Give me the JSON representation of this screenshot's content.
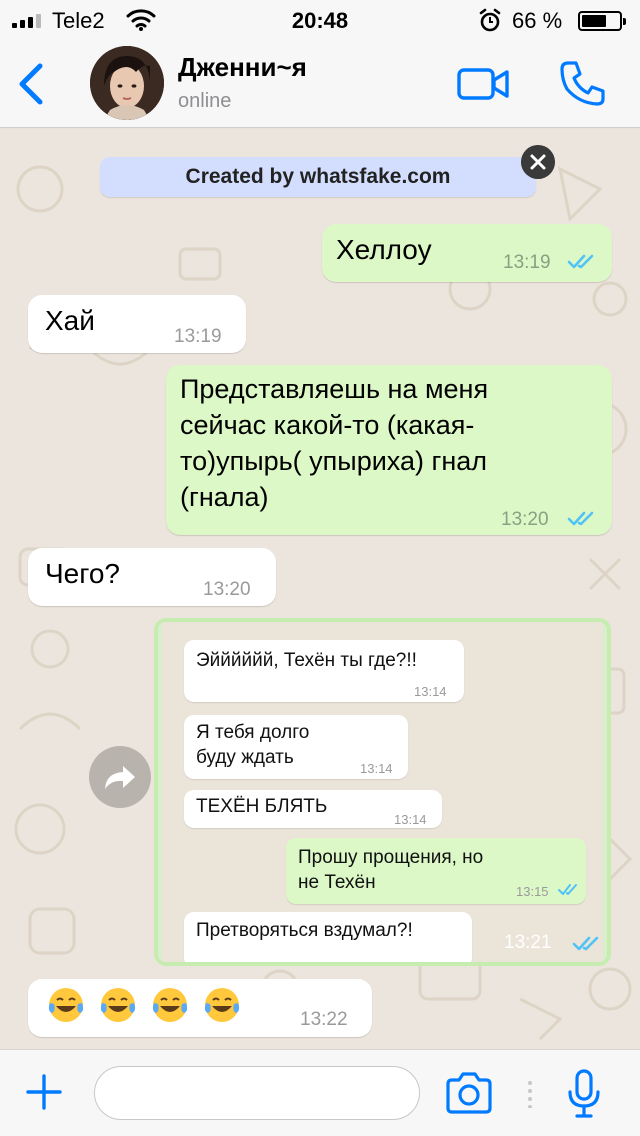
{
  "status_bar": {
    "carrier": "Tele2",
    "time": "20:48",
    "battery_percent": "66 %",
    "battery_level": 0.66
  },
  "header": {
    "contact_name": "Дженни~я",
    "contact_status": "online"
  },
  "watermark": {
    "text": "Created by whatsfake.com"
  },
  "messages": [
    {
      "direction": "out",
      "text": "Хеллоу",
      "time": "13:19",
      "read": true
    },
    {
      "direction": "in",
      "text": "Хай",
      "time": "13:19"
    },
    {
      "direction": "out",
      "lines": [
        "Представляешь на меня",
        "сейчас какой-то (какая-",
        "то)упырь( упыриха) гнал",
        "(гнала)"
      ],
      "time": "13:20",
      "read": true
    },
    {
      "direction": "in",
      "text": "Чего?",
      "time": "13:20"
    },
    {
      "direction": "out",
      "type": "image",
      "time": "13:21",
      "read": true
    },
    {
      "direction": "in",
      "text": "😂😂😂😂",
      "time": "13:22"
    }
  ],
  "screenshot_messages": [
    {
      "direction": "in",
      "lines": [
        "Эйййййй, Техён ты где?!!"
      ],
      "time": "13:14"
    },
    {
      "direction": "in",
      "lines": [
        "Я тебя долго",
        "буду ждать"
      ],
      "time": "13:14"
    },
    {
      "direction": "in",
      "lines": [
        "ТЕХЁН БЛЯТЬ"
      ],
      "time": "13:14"
    },
    {
      "direction": "out",
      "lines": [
        "Прошу прощения, но",
        "не Техён"
      ],
      "time": "13:15",
      "read": true
    },
    {
      "direction": "in",
      "lines": [
        "Претворяться вздумал?!"
      ]
    }
  ],
  "input": {
    "value": "",
    "placeholder": ""
  },
  "colors": {
    "accent": "#007aff",
    "outgoing_bubble": "#dcf8c6",
    "incoming_bubble": "#ffffff",
    "chat_background": "#ece5dd",
    "read_ticks": "#4fc3f7",
    "watermark_bg": "#d3deff"
  },
  "icons": [
    "signal-icon",
    "wifi-icon",
    "alarm-icon",
    "battery-icon",
    "back-chevron-icon",
    "video-call-icon",
    "phone-icon",
    "close-icon",
    "forward-icon",
    "read-ticks-icon",
    "plus-icon",
    "camera-icon",
    "microphone-icon"
  ]
}
